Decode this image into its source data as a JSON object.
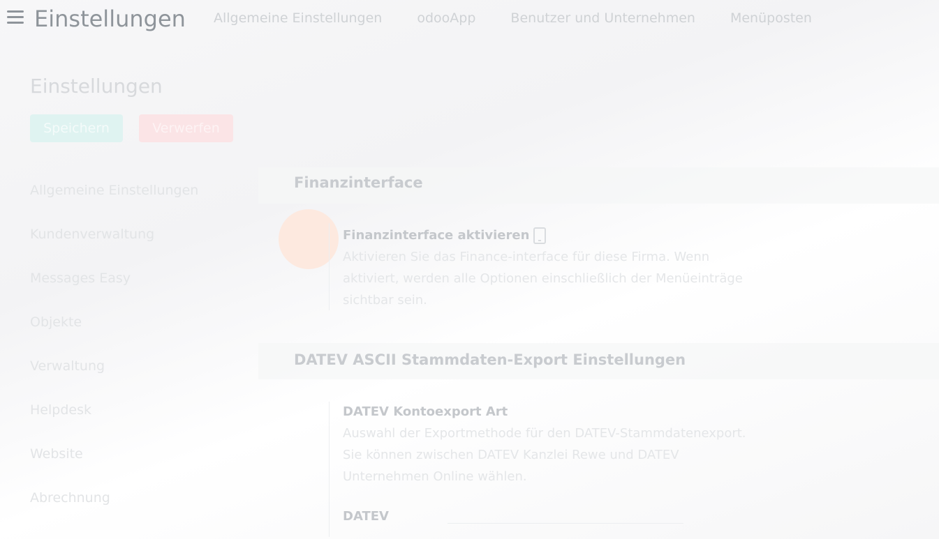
{
  "header": {
    "title": "Einstellungen",
    "nav": [
      "Allgemeine Einstellungen",
      "odooApp",
      "Benutzer und Unternehmen",
      "Menüposten"
    ]
  },
  "sidebar": {
    "title": "Einstellungen",
    "save_label": "Speichern",
    "discard_label": "Verwerfen",
    "items": [
      "Allgemeine Einstellungen",
      "Kundenverwaltung",
      "Messages Easy",
      "Objekte",
      "Verwaltung",
      "Helpdesk",
      "Website",
      "Abrechnung"
    ]
  },
  "main": {
    "section1": {
      "title": "Finanzinterface",
      "setting_label": "Finanzinterface aktivieren",
      "setting_desc": "Aktivieren Sie das Finance-interface für diese Firma. Wenn aktiviert, werden alle Optionen einschließlich der Menüeinträge sichtbar sein."
    },
    "section2": {
      "title": "DATEV ASCII Stammdaten-Export Einstellungen",
      "setting_label": "DATEV Kontoexport Art",
      "setting_desc": "Auswahl der Exportmethode für den DATEV-Stammdatenexport. Sie können zwischen DATEV Kanzlei Rewe und DATEV Unternehmen Online wählen.",
      "field_label": "DATEV"
    }
  },
  "colors": {
    "save_button": "#dff3f1",
    "discard_button": "#fbe4e6",
    "accent_circle": "#fde9df"
  }
}
